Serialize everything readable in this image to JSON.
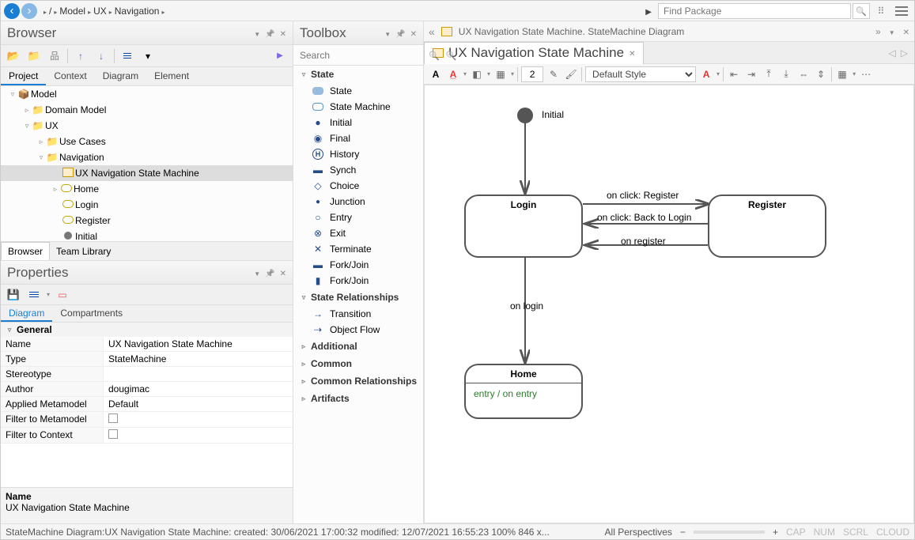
{
  "nav": {
    "crumbs": [
      "/",
      "Model",
      "UX",
      "Navigation"
    ],
    "find_placeholder": "Find Package"
  },
  "browser": {
    "title": "Browser",
    "tabs": [
      "Project",
      "Context",
      "Diagram",
      "Element"
    ],
    "active_tab": 0,
    "tree": {
      "root": "Model",
      "domain": "Domain Model",
      "ux": "UX",
      "usecases": "Use Cases",
      "navigation": "Navigation",
      "diagram": "UX Navigation State Machine",
      "states": [
        "Home",
        "Login",
        "Register",
        "Initial"
      ]
    },
    "bottom_tabs": [
      "Browser",
      "Team Library"
    ]
  },
  "properties": {
    "title": "Properties",
    "tabs": [
      "Diagram",
      "Compartments"
    ],
    "section": "General",
    "rows": {
      "name_k": "Name",
      "name_v": "UX Navigation State Machine",
      "type_k": "Type",
      "type_v": "StateMachine",
      "stereo_k": "Stereotype",
      "stereo_v": "",
      "author_k": "Author",
      "author_v": "dougimac",
      "meta_k": "Applied Metamodel",
      "meta_v": "Default",
      "filtm_k": "Filter to Metamodel",
      "filtc_k": "Filter to Context"
    },
    "footer_k": "Name",
    "footer_v": "UX Navigation State Machine"
  },
  "toolbox": {
    "title": "Toolbox",
    "search_placeholder": "Search",
    "sections": {
      "state": {
        "label": "State",
        "items": [
          "State",
          "State Machine",
          "Initial",
          "Final",
          "History",
          "Synch",
          "Choice",
          "Junction",
          "Entry",
          "Exit",
          "Terminate",
          "Fork/Join",
          "Fork/Join"
        ]
      },
      "rel": {
        "label": "State Relationships",
        "items": [
          "Transition",
          "Object Flow"
        ]
      },
      "additional": "Additional",
      "common": "Common",
      "commonrel": "Common Relationships",
      "artifacts": "Artifacts"
    }
  },
  "diagram": {
    "crumb_name": "UX Navigation State Machine.",
    "crumb_type": "StateMachine Diagram",
    "tab_title": "UX Navigation State Machine",
    "style_label": "Default Style",
    "line_width": "2",
    "initial_label": "Initial",
    "login": "Login",
    "register": "Register",
    "home": "Home",
    "entry_text": "entry / on entry",
    "t_register": "on click: Register",
    "t_back": "on click: Back to Login",
    "t_onreg": "on register",
    "t_onlogin": "on login"
  },
  "status": {
    "main": "StateMachine Diagram:UX Navigation State Machine:   created: 30/06/2021 17:00:32   modified: 12/07/2021 16:55:23    100%    846 x...",
    "persp": "All Perspectives",
    "cap": "CAP",
    "num": "NUM",
    "scrl": "SCRL",
    "cloud": "CLOUD"
  }
}
